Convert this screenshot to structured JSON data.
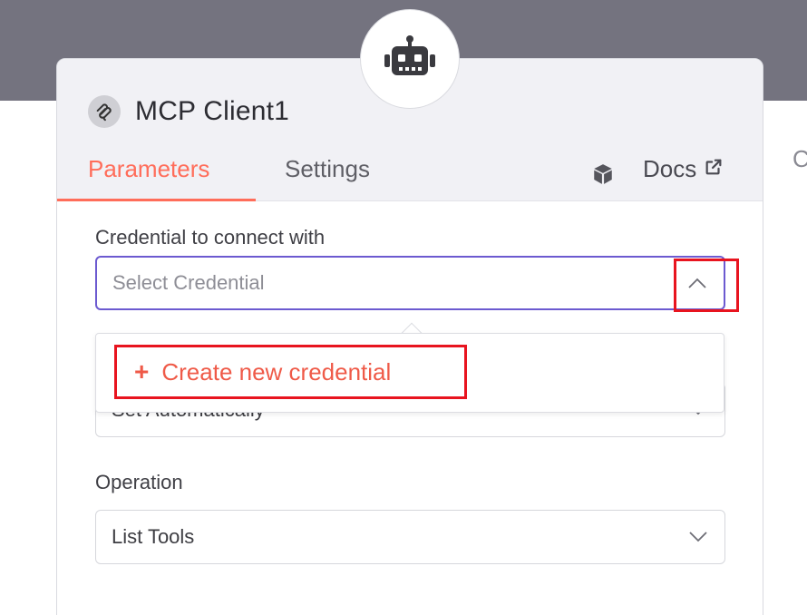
{
  "background": {
    "partial_text": "C"
  },
  "node": {
    "title": "MCP Client1",
    "tabs": [
      {
        "label": "Parameters"
      },
      {
        "label": "Settings"
      }
    ],
    "docs_label": "Docs"
  },
  "fields": {
    "credential": {
      "label": "Credential to connect with",
      "placeholder": "Select Credential"
    },
    "hidden": {
      "value": "Set Automatically"
    },
    "operation": {
      "label": "Operation",
      "value": "List Tools"
    }
  },
  "dropdown": {
    "create_label": "Create new credential",
    "plus": "+"
  },
  "colors": {
    "accent": "#ff6d5a",
    "focus_border": "#6c5ad0",
    "highlight": "#e8141f",
    "header_band": "#74737f"
  }
}
